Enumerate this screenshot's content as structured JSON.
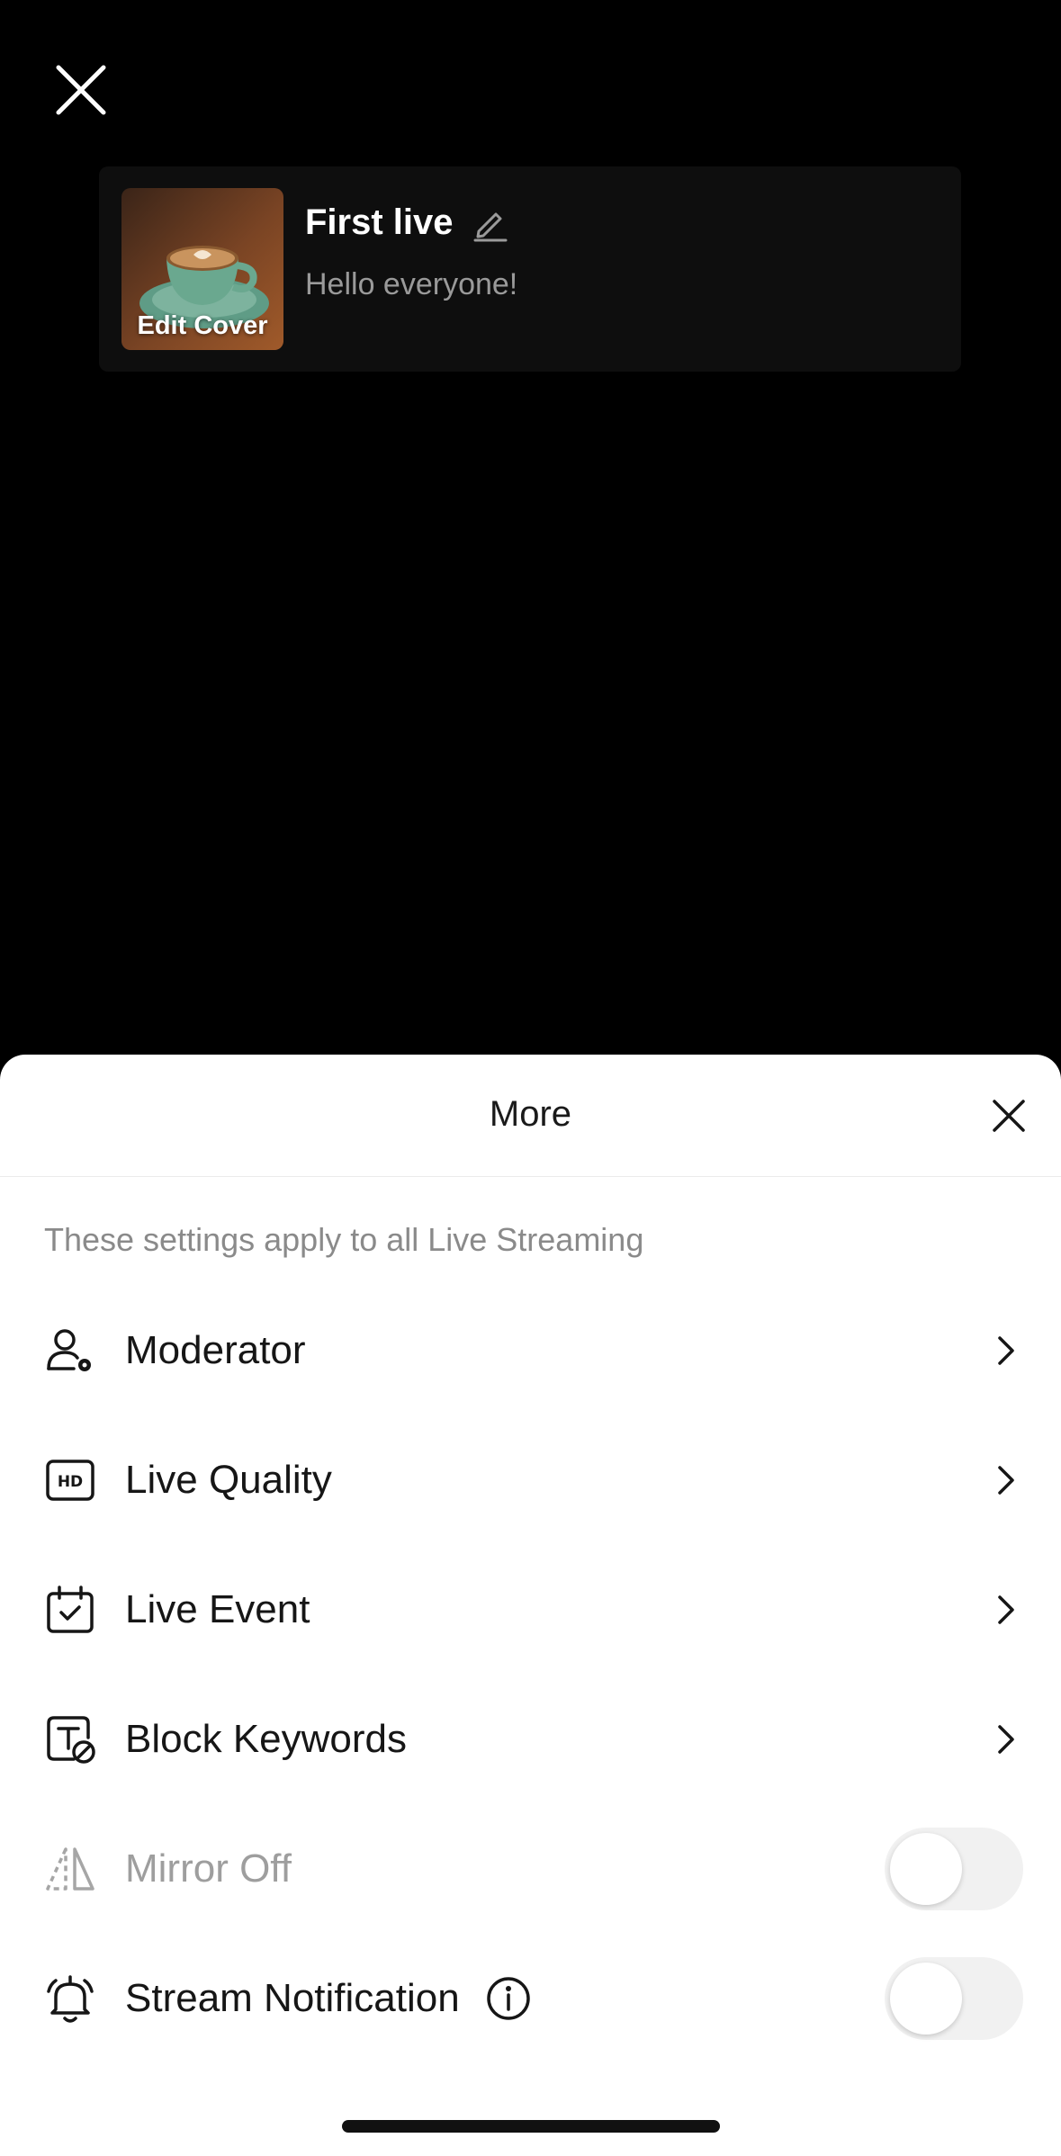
{
  "top": {
    "close_icon": "close-icon"
  },
  "live_card": {
    "cover_label": "Edit Cover",
    "title": "First live",
    "subtitle": "Hello everyone!",
    "edit_icon": "pencil-icon"
  },
  "sheet": {
    "title": "More",
    "note": "These settings apply to all Live Streaming",
    "items": [
      {
        "label": "Moderator",
        "icon": "moderator-icon",
        "control": "chevron"
      },
      {
        "label": "Live Quality",
        "icon": "hd-icon",
        "control": "chevron"
      },
      {
        "label": "Live Event",
        "icon": "calendar-check-icon",
        "control": "chevron"
      },
      {
        "label": "Block Keywords",
        "icon": "block-text-icon",
        "control": "chevron"
      },
      {
        "label": "Mirror Off",
        "icon": "mirror-icon",
        "control": "toggle",
        "enabled": false,
        "disabled": true
      },
      {
        "label": "Stream Notification",
        "icon": "bell-icon",
        "control": "toggle",
        "enabled": false,
        "info_icon": "info-icon"
      }
    ]
  },
  "colors": {
    "accent_toggle_off": "#f1f1f1",
    "text_primary": "#161616",
    "text_muted": "#8a8a8a"
  }
}
